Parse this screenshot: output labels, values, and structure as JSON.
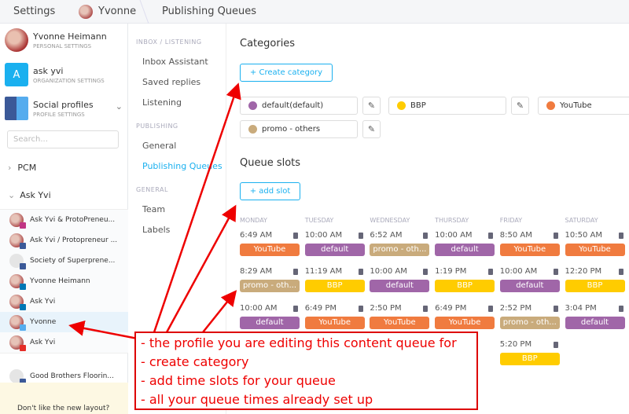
{
  "breadcrumb": [
    "Settings",
    "Yvonne",
    "Publishing Queues"
  ],
  "sidebar": {
    "personal": {
      "name": "Yvonne Heimann",
      "sub": "PERSONAL SETTINGS"
    },
    "org": {
      "letter": "A",
      "name": "ask yvi",
      "sub": "ORGANIZATION SETTINGS"
    },
    "social": {
      "name": "Social profiles",
      "sub": "PROFILE SETTINGS"
    },
    "search_placeholder": "Search...",
    "groups": [
      "PCM",
      "Ask Yvi"
    ],
    "profiles": [
      {
        "name": "Ask Yvi & ProtoPreneu...",
        "network": "instagram"
      },
      {
        "name": "Ask Yvi / Protopreneur ...",
        "network": "facebook"
      },
      {
        "name": "Society of Superprene...",
        "network": "facebook"
      },
      {
        "name": "Yvonne Heimann",
        "network": "linkedin"
      },
      {
        "name": "Ask Yvi",
        "network": "linkedin"
      },
      {
        "name": "Yvonne",
        "network": "twitter",
        "selected": true
      },
      {
        "name": "Ask Yvi",
        "network": "youtube"
      }
    ],
    "other_profile": {
      "name": "Good Brothers Floorin...",
      "network": "facebook"
    },
    "banner": "Don't like the new layout?"
  },
  "nav": {
    "inbox_header": "INBOX / LISTENING",
    "inbox_items": [
      "Inbox Assistant",
      "Saved replies",
      "Listening"
    ],
    "publishing_header": "PUBLISHING",
    "publishing_items": [
      "General",
      "Publishing Queues"
    ],
    "general_header": "GENERAL",
    "general_items": [
      "Team",
      "Labels"
    ]
  },
  "categories": {
    "title": "Categories",
    "create_label": "+ Create category",
    "items": [
      {
        "name": "default",
        "suffix": " (default)",
        "color": "#a066a8"
      },
      {
        "name": "BBP",
        "color": "#ffcc00"
      },
      {
        "name": "YouTube",
        "color": "#f07b3f"
      },
      {
        "name": "promo - others",
        "color": "#c9ab7c"
      }
    ]
  },
  "queue": {
    "title": "Queue slots",
    "add_label": "+ add slot",
    "days": [
      {
        "name": "MONDAY",
        "slots": [
          [
            "6:49 AM",
            "YouTube"
          ],
          [
            "8:29 AM",
            "promo - oth..."
          ],
          [
            "10:00 AM",
            "default"
          ]
        ]
      },
      {
        "name": "TUESDAY",
        "slots": [
          [
            "10:00 AM",
            "default"
          ],
          [
            "11:19 AM",
            "BBP"
          ],
          [
            "6:49 PM",
            "YouTube"
          ]
        ]
      },
      {
        "name": "WEDNESDAY",
        "slots": [
          [
            "6:52 AM",
            "promo - oth..."
          ],
          [
            "10:00 AM",
            "default"
          ],
          [
            "2:50 PM",
            "YouTube"
          ]
        ]
      },
      {
        "name": "THURSDAY",
        "slots": [
          [
            "10:00 AM",
            "default"
          ],
          [
            "1:19 PM",
            "BBP"
          ],
          [
            "6:49 PM",
            "YouTube"
          ]
        ]
      },
      {
        "name": "FRIDAY",
        "slots": [
          [
            "8:50 AM",
            "YouTube"
          ],
          [
            "10:00 AM",
            "default"
          ],
          [
            "2:52 PM",
            "promo - oth..."
          ],
          [
            "5:20 PM",
            "BBP"
          ]
        ]
      },
      {
        "name": "SATURDAY",
        "slots": [
          [
            "10:50 AM",
            "YouTube"
          ],
          [
            "12:20 PM",
            "BBP"
          ],
          [
            "3:04 PM",
            "default"
          ]
        ]
      }
    ]
  },
  "annotation": [
    "- the profile you are editing this content queue for",
    "- create category",
    "- add time slots for your queue",
    "- all your queue times already set up"
  ],
  "colors": {
    "accent": "#1ab0ef",
    "annotation": "#e00000",
    "YouTube": "#f07b3f",
    "default": "#a066a8",
    "promo": "#c9ab7c",
    "BBP": "#ffcc00"
  }
}
